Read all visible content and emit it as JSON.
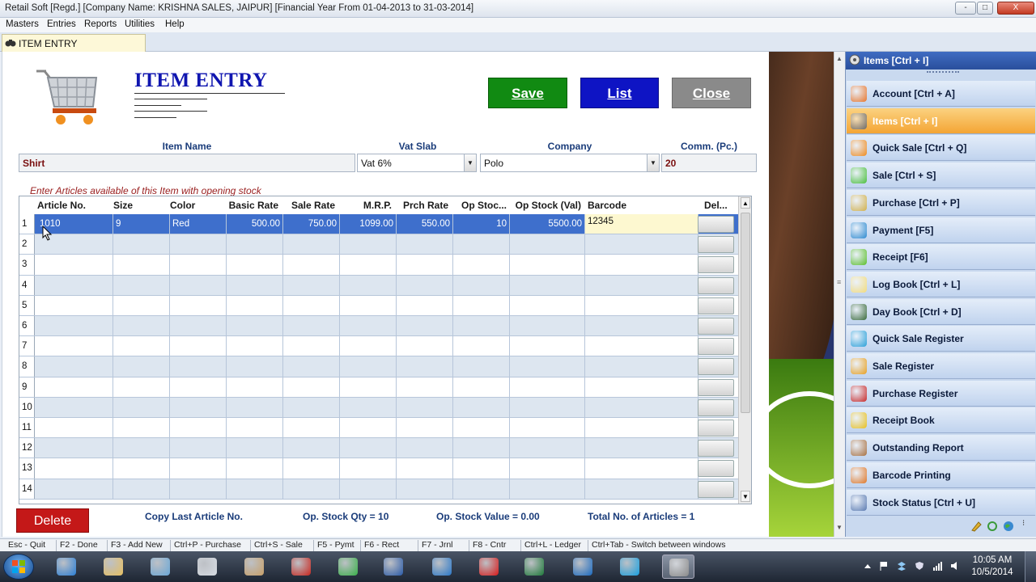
{
  "window": {
    "title": "Retail Soft [Regd.] [Company Name: KRISHNA SALES, JAIPUR] [Financial Year From 01-04-2013 to 31-03-2014]",
    "controls": [
      "-",
      "□",
      "X"
    ]
  },
  "menu": [
    "Masters",
    "Entries",
    "Reports",
    "Utilities",
    "Help"
  ],
  "tab": {
    "label": "ITEM ENTRY"
  },
  "form": {
    "title": "ITEM ENTRY",
    "buttons": {
      "save": "Save",
      "list": "List",
      "close": "Close"
    },
    "fields": {
      "item_name": {
        "label": "Item Name",
        "value": "Shirt"
      },
      "vat_slab": {
        "label": "Vat Slab",
        "value": "Vat 6%"
      },
      "company": {
        "label": "Company",
        "value": "Polo"
      },
      "comm": {
        "label": "Comm. (Pc.)",
        "value": "20"
      }
    },
    "hint": "Enter Articles available of this Item with opening stock"
  },
  "grid": {
    "columns": [
      "Article No.",
      "Size",
      "Color",
      "Basic Rate",
      "Sale Rate",
      "M.R.P.",
      "Prch Rate",
      "Op Stoc...",
      "Op Stock (Val)",
      "Barcode",
      "Del..."
    ],
    "rows": [
      {
        "n": "1",
        "article": "1010",
        "size": "9",
        "color": "Red",
        "basic": "500.00",
        "sale": "750.00",
        "mrp": "1099.00",
        "prch": "550.00",
        "opqty": "10",
        "opval": "5500.00",
        "barcode": "12345"
      },
      {
        "n": "2"
      },
      {
        "n": "3"
      },
      {
        "n": "4"
      },
      {
        "n": "5"
      },
      {
        "n": "6"
      },
      {
        "n": "7"
      },
      {
        "n": "8"
      },
      {
        "n": "9"
      },
      {
        "n": "10"
      },
      {
        "n": "11"
      },
      {
        "n": "12"
      },
      {
        "n": "13"
      },
      {
        "n": "14"
      }
    ]
  },
  "summary": {
    "delete": "Delete",
    "copy_last": "Copy Last Article No.",
    "op_qty": "Op. Stock Qty = 10",
    "op_val": "Op. Stock Value = 0.00",
    "total_articles": "Total No. of Articles = 1"
  },
  "sidebar": {
    "header": "Items [Ctrl + I]",
    "items": [
      {
        "label": "Account [Ctrl + A]",
        "icon": "account-icon",
        "color": "#e8762c"
      },
      {
        "label": "Items [Ctrl + I]",
        "icon": "items-icon",
        "color": "#6a6a6a",
        "active": true
      },
      {
        "label": "Quick Sale [Ctrl + Q]",
        "icon": "cone-icon",
        "color": "#f08a1c"
      },
      {
        "label": "Sale [Ctrl + S]",
        "icon": "sale-icon",
        "color": "#4bbf3a"
      },
      {
        "label": "Purchase [Ctrl + P]",
        "icon": "purchase-icon",
        "color": "#d2b04a"
      },
      {
        "label": "Payment [F5]",
        "icon": "globe-icon",
        "color": "#2d8ad0"
      },
      {
        "label": "Receipt [F6]",
        "icon": "receipt-icon",
        "color": "#5cbf2a"
      },
      {
        "label": "Log Book [Ctrl + L]",
        "icon": "log-book-icon",
        "color": "#f3dc7c"
      },
      {
        "label": "Day Book [Ctrl + D]",
        "icon": "day-book-icon",
        "color": "#3a6a3a"
      },
      {
        "label": "Quick Sale Register",
        "icon": "register-icon",
        "color": "#2aa0d8"
      },
      {
        "label": "Sale Register",
        "icon": "user-icon",
        "color": "#e8a020"
      },
      {
        "label": "Purchase Register",
        "icon": "person-icon",
        "color": "#c82a2a"
      },
      {
        "label": "Receipt Book",
        "icon": "magnifier-icon",
        "color": "#e8c020"
      },
      {
        "label": "Outstanding Report",
        "icon": "book-icon",
        "color": "#a87040"
      },
      {
        "label": "Barcode Printing",
        "icon": "home-icon",
        "color": "#e07828"
      },
      {
        "label": "Stock Status [Ctrl + U]",
        "icon": "stock-icon",
        "color": "#5a7ab0"
      }
    ]
  },
  "status": [
    "Esc - Quit",
    "F2 - Done",
    "F3 - Add New",
    "Ctrl+P - Purchase",
    "Ctrl+S - Sale",
    "F5 - Pymt",
    "F6 - Rect",
    "F7 - Jrnl",
    "F8 - Cntr",
    "Ctrl+L - Ledger",
    "Ctrl+Tab - Switch between windows"
  ],
  "taskbar": {
    "time": "10:05 AM",
    "date": "10/5/2014",
    "apps": [
      {
        "icon": "ie-icon",
        "color": "#2b7fd6"
      },
      {
        "icon": "folder-icon",
        "color": "#e8c060"
      },
      {
        "icon": "notebook-icon",
        "color": "#6aa8d8"
      },
      {
        "icon": "file-icon",
        "color": "#d8dde4"
      },
      {
        "icon": "paint-icon",
        "color": "#c8a068"
      },
      {
        "icon": "acrobat-icon",
        "color": "#c8261e"
      },
      {
        "icon": "gem-icon",
        "color": "#3ab04a"
      },
      {
        "icon": "word-icon",
        "color": "#2a5aa8"
      },
      {
        "icon": "triangle-app-icon",
        "color": "#2a78c8"
      },
      {
        "icon": "opera-icon",
        "color": "#d81a1a"
      },
      {
        "icon": "excel-icon",
        "color": "#1e7a3a"
      },
      {
        "icon": "maxthon-icon",
        "color": "#1a6ac0"
      },
      {
        "icon": "skype-icon",
        "color": "#18a0e0"
      },
      {
        "icon": "retail-soft-icon",
        "color": "#8a8a8a"
      }
    ]
  }
}
